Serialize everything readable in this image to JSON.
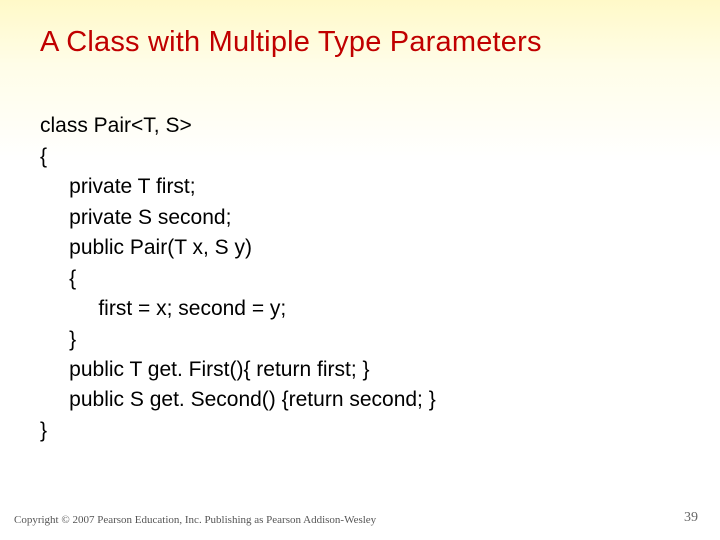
{
  "title": "A Class with Multiple Type Parameters",
  "code": {
    "l0": "class Pair<T, S>",
    "l1": "{",
    "l2": "     private T first;",
    "l3": "     private S second;",
    "l4": "     public Pair(T x, S y)",
    "l5": "     {",
    "l6": "          first = x; second = y;",
    "l7": "     }",
    "l8": "     public T get. First(){ return first; }",
    "l9": "     public S get. Second() {return second; }",
    "l10": "}"
  },
  "footer": "Copyright © 2007 Pearson Education, Inc. Publishing as Pearson Addison-Wesley",
  "pagenum": "39"
}
